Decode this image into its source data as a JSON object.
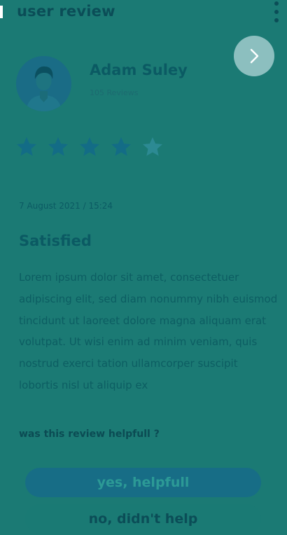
{
  "header": {
    "title": "user review"
  },
  "reviewer": {
    "name": "Adam Suley",
    "review_count": "105 Reviews"
  },
  "rating": {
    "value": 4,
    "max": 5
  },
  "review": {
    "date": "7 August 2021 / 15:24",
    "title": "Satisfied",
    "body": "Lorem ipsum dolor sit amet, consectetuer adipiscing elit, sed diam nonummy nibh euismod tincidunt ut laoreet dolore magna aliquam erat volutpat. Ut wisi enim ad minim veniam, quis nostrud exerci tation ullamcorper suscipit lobortis nisl ut aliquip ex"
  },
  "feedback": {
    "question": "was this review helpfull ?",
    "yes_label": "yes, helpfull",
    "no_label": "no, didn't help"
  },
  "colors": {
    "overlay_background": "#1b7a74",
    "star_filled": "#136c86",
    "star_empty": "#2c8a93",
    "next_button": "#8cbfbf"
  },
  "icons": {
    "back": "back-indicator",
    "menu": "more-vertical-icon",
    "next": "chevron-right-icon",
    "avatar": "user-avatar-icon",
    "star": "star-icon"
  }
}
